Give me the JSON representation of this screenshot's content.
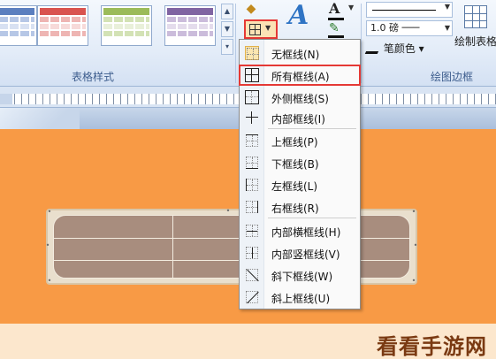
{
  "ribbon": {
    "groups": {
      "table_styles": "表格样式",
      "draw_borders": "绘图边框"
    },
    "line_weight": "1.0 磅",
    "pen_color": "笔颜色",
    "draw_table": "绘制表格"
  },
  "menu": {
    "items": [
      {
        "label": "无框线(N)",
        "icon": "no-border-icon"
      },
      {
        "label": "所有框线(A)",
        "icon": "all-borders-icon"
      },
      {
        "label": "外侧框线(S)",
        "icon": "outside-borders-icon"
      },
      {
        "label": "内部框线(I)",
        "icon": "inside-borders-icon"
      },
      {
        "label": "上框线(P)",
        "icon": "top-border-icon"
      },
      {
        "label": "下框线(B)",
        "icon": "bottom-border-icon"
      },
      {
        "label": "左框线(L)",
        "icon": "left-border-icon"
      },
      {
        "label": "右框线(R)",
        "icon": "right-border-icon"
      },
      {
        "label": "内部横框线(H)",
        "icon": "inside-horizontal-border-icon"
      },
      {
        "label": "内部竖框线(V)",
        "icon": "inside-vertical-border-icon"
      },
      {
        "label": "斜下框线(W)",
        "icon": "diagonal-down-border-icon"
      },
      {
        "label": "斜上框线(U)",
        "icon": "diagonal-up-border-icon"
      }
    ],
    "highlighted": "所有框线(A)"
  },
  "watermark": "看看手游网",
  "colors": {
    "slide_background": "#f89a45",
    "highlight_outline": "#e53935",
    "table_fill": "#a88d7e",
    "style_thumb_blue": "#5b7fbf",
    "style_thumb_red": "#d9534f",
    "style_thumb_green": "#9bbb59",
    "style_thumb_purple": "#8064a2"
  }
}
